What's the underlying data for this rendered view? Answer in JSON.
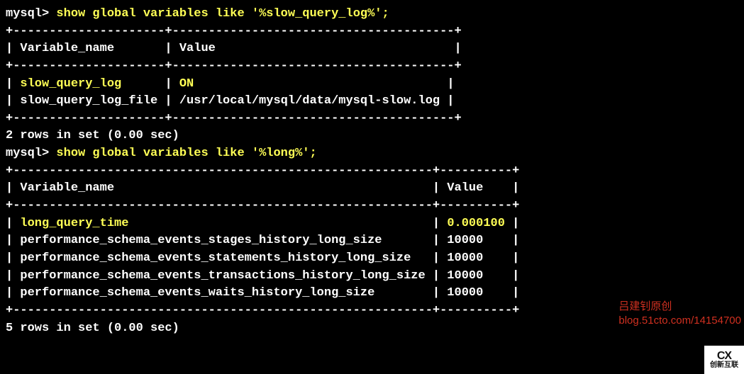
{
  "prompt": "mysql> ",
  "query1": {
    "command": "show global variables like '%slow_query_log%';",
    "border_top": "+---------------------+---------------------------------------+",
    "header": "| Variable_name       | Value                                 |",
    "rows": [
      {
        "name": "slow_query_log",
        "name_padded": "slow_query_log      ",
        "value": "ON                                   ",
        "highlight": true
      },
      {
        "name": "slow_query_log_file",
        "name_padded": "slow_query_log_file ",
        "value": "/usr/local/mysql/data/mysql-slow.log ",
        "highlight": false
      }
    ],
    "summary": "2 rows in set (0.00 sec)"
  },
  "query2": {
    "command": "show global variables like '%long%';",
    "border_top": "+----------------------------------------------------------+----------+",
    "header": "| Variable_name                                            | Value    |",
    "rows": [
      {
        "name": "long_query_time",
        "name_padded": "long_query_time                                          ",
        "value": "0.000100 ",
        "highlight": true
      },
      {
        "name": "performance_schema_events_stages_history_long_size",
        "name_padded": "performance_schema_events_stages_history_long_size       ",
        "value": "10000    ",
        "highlight": false
      },
      {
        "name": "performance_schema_events_statements_history_long_size",
        "name_padded": "performance_schema_events_statements_history_long_size   ",
        "value": "10000    ",
        "highlight": false
      },
      {
        "name": "performance_schema_events_transactions_history_long_size",
        "name_padded": "performance_schema_events_transactions_history_long_size ",
        "value": "10000    ",
        "highlight": false
      },
      {
        "name": "performance_schema_events_waits_history_long_size",
        "name_padded": "performance_schema_events_waits_history_long_size        ",
        "value": "10000    ",
        "highlight": false
      }
    ],
    "summary": "5 rows in set (0.00 sec)"
  },
  "watermark": {
    "line1": "吕建钊原创",
    "line2": "blog.51cto.com/14154700"
  },
  "logo_text": "创新互联"
}
